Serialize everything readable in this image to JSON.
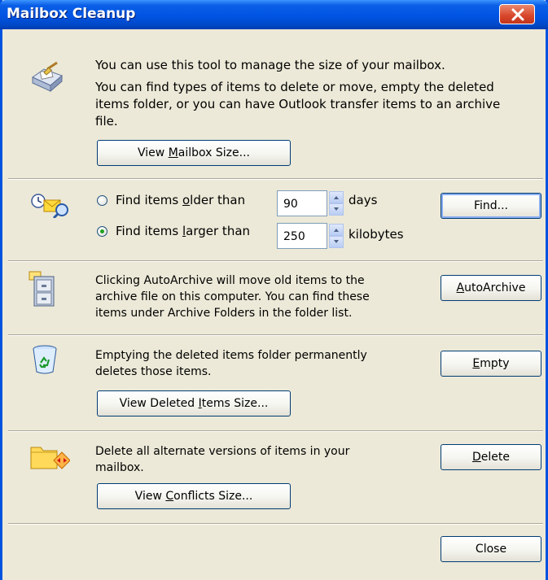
{
  "window": {
    "title": "Mailbox Cleanup"
  },
  "section_manage": {
    "intro": "You can use this tool to manage the size of your mailbox.",
    "description_lines": [
      "You can find types of items to delete or move, empty the deleted",
      "items folder, or you can have Outlook transfer items to an archive",
      "file."
    ],
    "view_size_button": {
      "pre": "View ",
      "key": "M",
      "post": "ailbox Size..."
    }
  },
  "section_find": {
    "older": {
      "pre": "Find items ",
      "key": "o",
      "post": "lder than",
      "value": "90",
      "unit": "days",
      "selected": false
    },
    "larger": {
      "pre": "Find items ",
      "key": "l",
      "post": "arger than",
      "value": "250",
      "unit": "kilobytes",
      "selected": true
    },
    "find_button": "Find..."
  },
  "section_archive": {
    "lines": [
      "Clicking AutoArchive will move old items to the",
      "archive file on this computer. You can find these",
      "items under Archive Folders in the folder list."
    ],
    "button": {
      "pre": "",
      "key": "A",
      "post": "utoArchive"
    }
  },
  "section_deleted": {
    "lines": [
      "Emptying the deleted items folder permanently",
      "deletes those items."
    ],
    "empty_button": {
      "pre": "",
      "key": "E",
      "post": "mpty"
    },
    "view_button": {
      "pre": "View Deleted ",
      "key": "I",
      "post": "tems Size..."
    }
  },
  "section_conflicts": {
    "lines": [
      "Delete all alternate versions of items in your",
      "mailbox."
    ],
    "delete_button": {
      "pre": "",
      "key": "D",
      "post": "elete"
    },
    "view_button": {
      "pre": "View ",
      "key": "C",
      "post": "onflicts Size..."
    }
  },
  "footer": {
    "close_button": "Close"
  },
  "colors": {
    "titlebar": "#0054e3",
    "dialog_bg": "#ece9d8",
    "close_red": "#d8452a",
    "radio_dot": "#21a121"
  },
  "icons": [
    "mailbox-cleanup-icon",
    "find-items-icon",
    "autoarchive-cabinet-icon",
    "recycle-bin-icon",
    "conflicts-folder-icon",
    "close-icon"
  ]
}
